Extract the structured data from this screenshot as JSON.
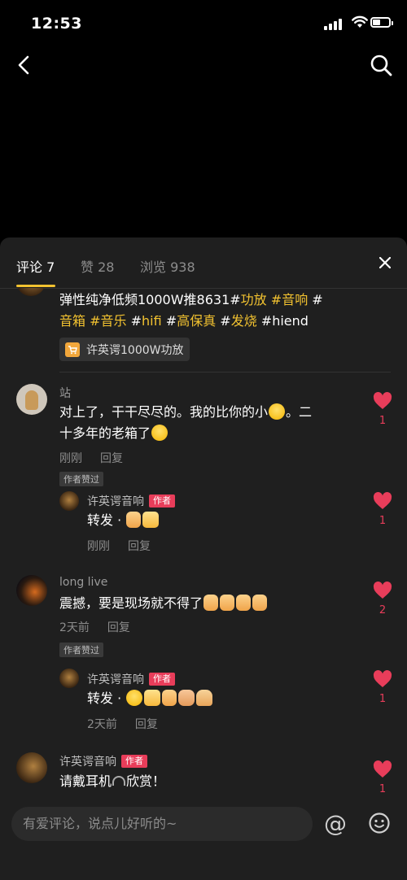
{
  "status": {
    "time": "12:53"
  },
  "tabs": [
    {
      "label": "评论 7"
    },
    {
      "label": "赞 28"
    },
    {
      "label": "浏览 938"
    }
  ],
  "post": {
    "text_line1_plain": "弹性纯净低频1000W推8631#",
    "tag1": "功放",
    "tag2": "#音响",
    "hash3": " #",
    "tag3": "音箱",
    "tag4": " #音乐",
    "hash5": " #",
    "tag5": "hifi",
    "hash6": " #",
    "tag6": "高保真",
    "hash7": " #",
    "tag7": "发烧",
    "tail": " #hiend",
    "product": "许英谔1000W功放"
  },
  "comments": [
    {
      "user": "站",
      "text1": "对上了，干干尽尽的。我的比你的小",
      "text2": "。二",
      "text3": "十多年的老箱了",
      "time": "刚刚",
      "reply": "回复",
      "liked_badge": "作者赞过",
      "likes": "1",
      "sub": {
        "user": "许英谔音响",
        "badge": "作者",
        "text": "转发 ·",
        "time": "刚刚",
        "reply": "回复",
        "likes": "1"
      }
    },
    {
      "user": "long  live",
      "text": "震撼，要是现场就不得了",
      "time": "2天前",
      "reply": "回复",
      "liked_badge": "作者赞过",
      "likes": "2",
      "sub": {
        "user": "许英谔音响",
        "badge": "作者",
        "text": "转发 ·",
        "time": "2天前",
        "reply": "回复",
        "likes": "1"
      }
    },
    {
      "user": "许英谔音响",
      "badge": "作者",
      "text_a": "请戴耳机",
      "text_b": "欣赏！",
      "likes": "1"
    }
  ],
  "input": {
    "placeholder": "有爱评论，说点儿好听的~"
  },
  "colors": {
    "accent": "#f2c230",
    "like": "#e83d5a",
    "sheet": "#1f1f1f"
  }
}
